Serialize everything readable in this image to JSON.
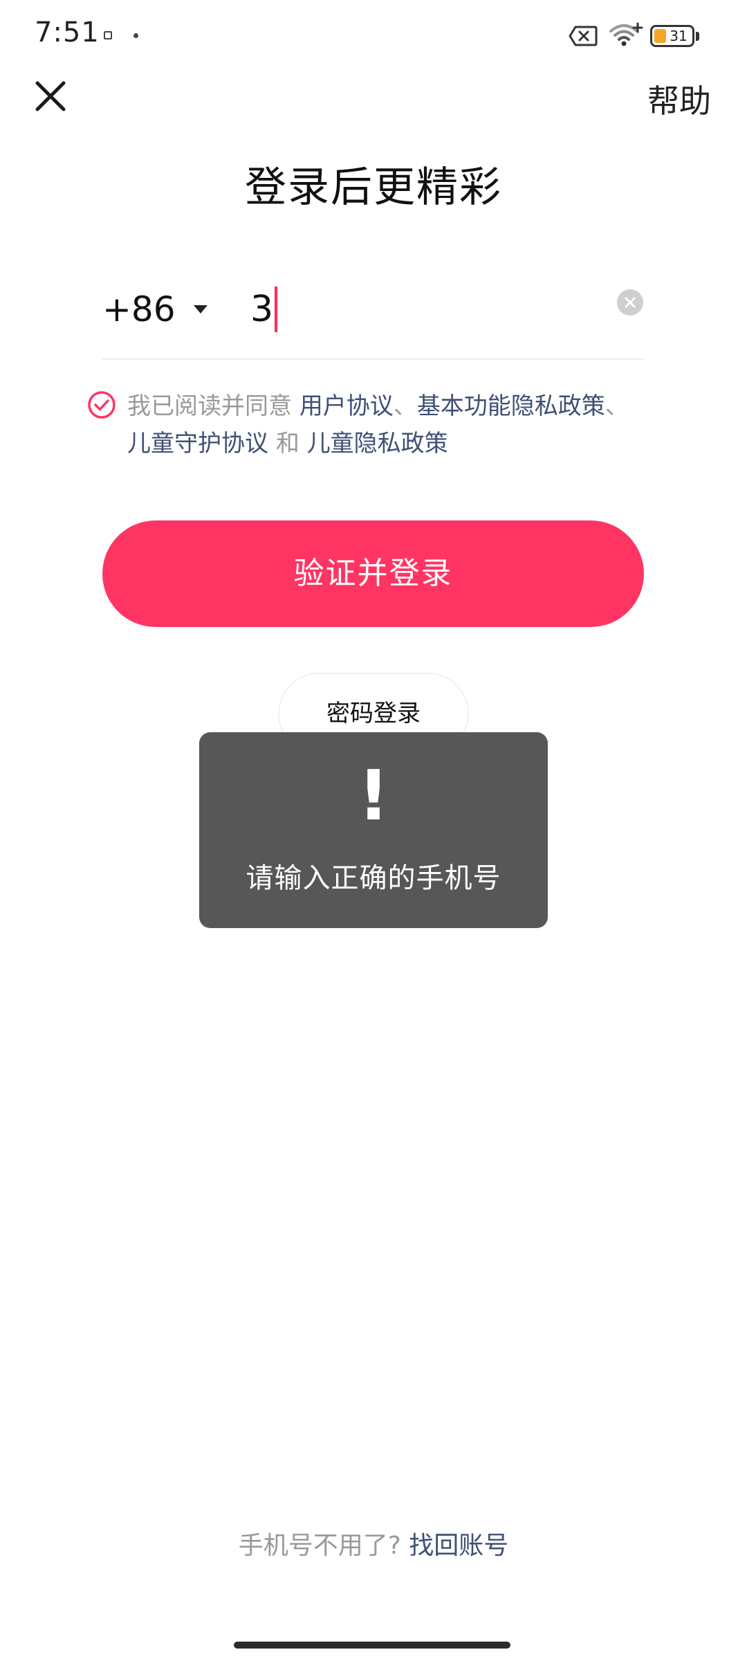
{
  "status_bar": {
    "time": "7:51",
    "battery_level": "31",
    "icons": [
      "notification-icon",
      "dot-icon",
      "sim-off-icon",
      "wifi-icon",
      "battery-icon"
    ]
  },
  "nav": {
    "close_icon": "close-icon",
    "help_label": "帮助"
  },
  "title": "登录后更精彩",
  "phone": {
    "country_code": "+86",
    "value": "3",
    "clear_icon": "clear-icon"
  },
  "agreement": {
    "prefix": "我已阅读并同意",
    "user_agreement": "用户协议",
    "sep1": "、",
    "privacy_policy": "基本功能隐私政策",
    "sep2": "、",
    "child_protection": "儿童守护协议",
    "and": "和",
    "child_privacy": "儿童隐私政策",
    "checked": true
  },
  "login_button": "验证并登录",
  "password_login": "密码登录",
  "toast": {
    "icon": "!",
    "message": "请输入正确的手机号"
  },
  "recover": {
    "prompt": "手机号不用了?",
    "link": "找回账号"
  },
  "colors": {
    "accent": "#fe3563",
    "link": "#3f5074",
    "toast_bg": "#575757"
  }
}
